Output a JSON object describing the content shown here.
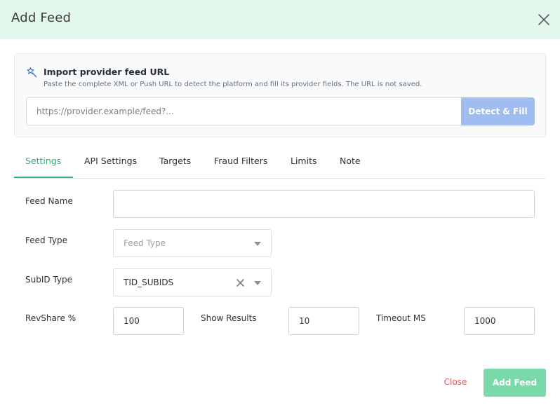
{
  "modal": {
    "title": "Add Feed"
  },
  "import": {
    "title": "Import provider feed URL",
    "description": "Paste the complete XML or Push URL to detect the platform and fill its provider fields. The URL is not saved.",
    "url_placeholder": "https://provider.example/feed?...",
    "url_value": "",
    "detect_label": "Detect & Fill",
    "icon": "magic-wand-icon"
  },
  "tabs": [
    {
      "label": "Settings",
      "active": true
    },
    {
      "label": "API Settings",
      "active": false
    },
    {
      "label": "Targets",
      "active": false
    },
    {
      "label": "Fraud Filters",
      "active": false
    },
    {
      "label": "Limits",
      "active": false
    },
    {
      "label": "Note",
      "active": false
    }
  ],
  "form": {
    "feed_name": {
      "label": "Feed Name",
      "value": "",
      "placeholder": ""
    },
    "feed_type": {
      "label": "Feed Type",
      "placeholder": "Feed Type",
      "value": ""
    },
    "subid_type": {
      "label": "SubID Type",
      "value": "TID_SUBIDS"
    },
    "revshare": {
      "label": "RevShare %",
      "value": "100"
    },
    "show_results": {
      "label": "Show Results",
      "value": "10"
    },
    "timeout_ms": {
      "label": "Timeout MS",
      "value": "1000"
    }
  },
  "footer": {
    "close_label": "Close",
    "submit_label": "Add Feed"
  },
  "colors": {
    "header_bg": "#e3f7ec",
    "accent_green": "#2fb171",
    "detect_button": "#9fbdf1",
    "submit_button": "#79d9a9",
    "close_text": "#e05555",
    "import_icon": "#3b6fd8"
  }
}
